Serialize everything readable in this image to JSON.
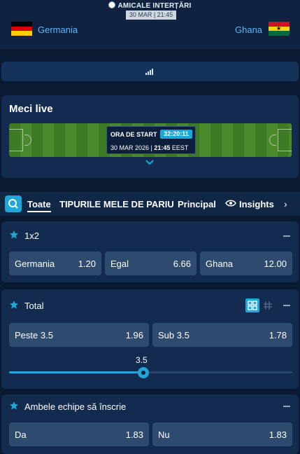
{
  "header": {
    "competition": "AMICALE INTERȚĂRI",
    "datetime": "30 MAR | 21:45",
    "home_team": "Germania",
    "away_team": "Ghana",
    "home_flag_colors": [
      "#000000",
      "#dd0000",
      "#ffce00"
    ],
    "away_flag_colors": [
      "#ce1126",
      "#fcd116",
      "#006b3f"
    ]
  },
  "live": {
    "title": "Meci live",
    "start_label": "ORA DE START",
    "countdown": "32:20:11",
    "start_date": "30 MAR 2026 | ",
    "start_time": "21:45",
    "timezone": " EEST"
  },
  "tabs": {
    "items": [
      "Toate",
      "TIPURILE MELE DE PARIU",
      "Principal",
      "Insights"
    ],
    "active": "Toate"
  },
  "markets": [
    {
      "title": "1x2",
      "selections": [
        {
          "label": "Germania",
          "odds": "1.20"
        },
        {
          "label": "Egal",
          "odds": "6.66"
        },
        {
          "label": "Ghana",
          "odds": "12.00"
        }
      ]
    },
    {
      "title": "Total",
      "selections": [
        {
          "label": "Peste 3.5",
          "odds": "1.96"
        },
        {
          "label": "Sub 3.5",
          "odds": "1.78"
        }
      ],
      "line_value": "3.5"
    },
    {
      "title": "Ambele echipe să înscrie",
      "selections": [
        {
          "label": "Da",
          "odds": "1.83"
        },
        {
          "label": "Nu",
          "odds": "1.83"
        }
      ]
    }
  ],
  "colors": {
    "accent": "#1fa7d8",
    "team_link": "#5ab8ff",
    "background": "#0b1a33",
    "card": "#132b4e",
    "odds_button": "#2e4a6e"
  }
}
